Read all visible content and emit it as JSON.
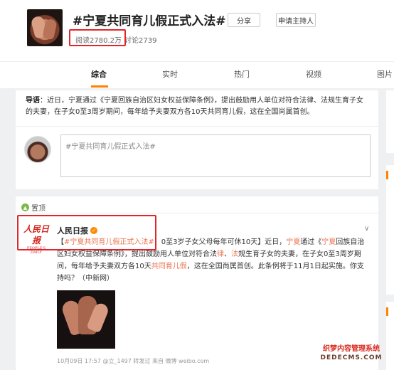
{
  "topic": {
    "title": "#宁夏共同育儿假正式入法#",
    "share_label": "分享",
    "apply_label": "申请主持人",
    "read_count": "阅读2780.2万",
    "discuss_count": "讨论2739"
  },
  "tabs": [
    {
      "label": "综合"
    },
    {
      "label": "实时"
    },
    {
      "label": "热门"
    },
    {
      "label": "视频"
    },
    {
      "label": "图片"
    }
  ],
  "guide": {
    "prefix": "导语",
    "text": "：近日，宁夏通过《宁夏回族自治区妇女权益保障条例》，提出鼓励用人单位对符合法律、法规生育子女的夫妻，在子女0至3周岁期间，每年给予夫妻双方各10天共同育儿假，这在全国尚属首创。"
  },
  "composer": {
    "placeholder": "#宁夏共同育儿假正式入法#"
  },
  "post": {
    "pinned_label": "置顶",
    "author": "人民日报",
    "logo_text": "人民日报",
    "logo_sub": "PEOPLE'S DAILY",
    "text_open": "【",
    "text_hashtag": "#宁夏共同育儿假正式入法#",
    "text_1": "：0至3岁子女父母每年可休10天】近日，",
    "text_ningxia1": "宁夏",
    "text_2": "通过《",
    "text_ningxia2": "宁夏",
    "text_3": "回族自治区妇女权益保障条例》，提出鼓励用人单位对符合法",
    "text_lu": "律",
    "text_4": "、",
    "text_fa": "法",
    "text_5": "规生育子女的夫妻，在子女0至3周岁期间，每年给予夫妻双方各10天",
    "text_gongtong": "共同育儿假",
    "text_6": "，这在全国尚属首创。此条例将于11月1日起实施。你支持吗？（中新网）",
    "meta": "10月09日 17:57 @立_1497 转发过  来自 微博 weibo.com"
  },
  "watermark": {
    "line1": "织梦内容管理系统",
    "line2": "DEDECMS.COM"
  },
  "colors": {
    "accent": "#ff8200",
    "highlight": "#eb7350",
    "annotation": "#e0262b"
  }
}
